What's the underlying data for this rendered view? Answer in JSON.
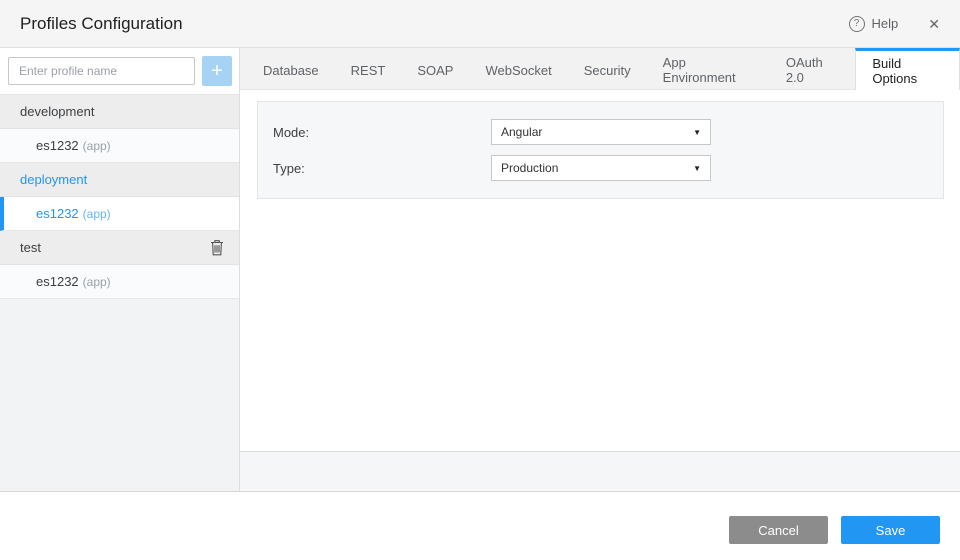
{
  "header": {
    "title": "Profiles Configuration",
    "help_label": "Help",
    "help_icon_glyph": "?",
    "close_icon_glyph": "✕"
  },
  "sidebar": {
    "input_placeholder": "Enter profile name",
    "add_button_glyph": "+",
    "profiles": [
      {
        "name": "development",
        "selected": false,
        "apps": [
          {
            "label": "es1232",
            "suffix": "(app)",
            "selected": false
          }
        ]
      },
      {
        "name": "deployment",
        "selected": true,
        "apps": [
          {
            "label": "es1232",
            "suffix": "(app)",
            "selected": true
          }
        ]
      },
      {
        "name": "test",
        "selected": false,
        "has_delete_icon": true,
        "apps": [
          {
            "label": "es1232",
            "suffix": "(app)",
            "selected": false
          }
        ]
      }
    ]
  },
  "tabs": {
    "items": [
      "Database",
      "REST",
      "SOAP",
      "WebSocket",
      "Security",
      "App Environment",
      "OAuth 2.0",
      "Build Options"
    ],
    "active": "Build Options"
  },
  "form": {
    "fields": [
      {
        "label": "Mode:",
        "value": "Angular"
      },
      {
        "label": "Type:",
        "value": "Production"
      }
    ],
    "dropdown_arrow_glyph": "▼"
  },
  "footer": {
    "cancel_label": "Cancel",
    "save_label": "Save"
  },
  "icons": {
    "help": "circled-question-mark",
    "close": "x-cross",
    "add": "plus",
    "delete": "trash-can",
    "dropdown": "caret-down"
  },
  "colors": {
    "accent_blue": "#2196f3",
    "add_button_blue": "#a6d3f3",
    "cancel_gray": "#8c8c8c",
    "selected_text_blue": "#2196f3"
  }
}
